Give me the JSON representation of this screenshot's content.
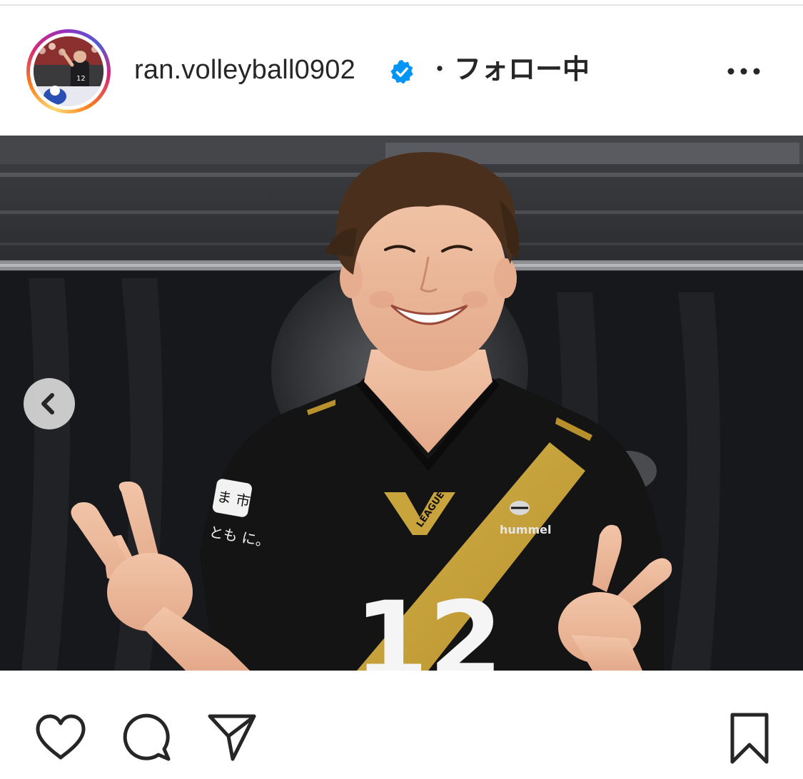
{
  "post": {
    "username": "ran.volleyball0902",
    "separator": "・",
    "follow_status": "フォロー中",
    "verified": true,
    "menu_icon": "more-horizontal-icon",
    "photo": {
      "jersey_number": "12",
      "jersey_sleeve_text": "とも に。",
      "jersey_patch_text": "ま 市",
      "jersey_logo_text": "LEAGUE",
      "jersey_brand_text": "hummel"
    },
    "carousel": {
      "prev_icon": "chevron-left-icon"
    },
    "actions": {
      "like_icon": "heart-icon",
      "comment_icon": "comment-icon",
      "share_icon": "send-icon",
      "save_icon": "bookmark-icon"
    }
  },
  "colors": {
    "text": "#262626",
    "verified": "#0095f6",
    "jersey_gold": "#c9a43c",
    "jersey_black": "#141414"
  }
}
